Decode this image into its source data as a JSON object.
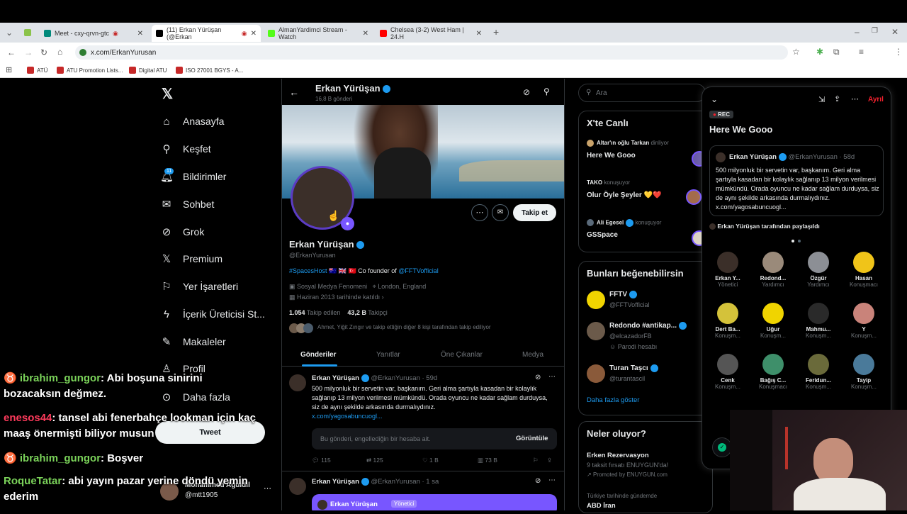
{
  "browser": {
    "tabs": [
      {
        "title": "Meet - cxy-qrvn-gtc"
      },
      {
        "title": "(11) Erkan Yürüşan (@Erkan"
      },
      {
        "title": "AlmanYardimci Stream - Watch"
      },
      {
        "title": "Chelsea (3-2) West Ham | 24.H"
      }
    ],
    "url": "x.com/ErkanYurusan",
    "bookmarks": [
      "ATÜ",
      "ATU Promotion Lists...",
      "Digital ATU",
      "ISO 27001 BGYS - A..."
    ]
  },
  "nav": {
    "items": [
      "Anasayfa",
      "Keşfet",
      "Bildirimler",
      "Sohbet",
      "Grok",
      "Premium",
      "Yer İşaretleri",
      "İçerik Üreticisi St...",
      "Makaleler",
      "Profil",
      "Daha fazla"
    ],
    "notif_badge": "11",
    "tweet_button": "Tweet",
    "account_name": "Mohammed Aguidil",
    "account_handle": "@mtt1905"
  },
  "profile": {
    "header_name": "Erkan Yürüşan",
    "header_posts": "16,8 B gönderi",
    "name": "Erkan Yürüşan",
    "handle": "@ErkanYurusan",
    "bio_tag": "#SpacesHost",
    "bio_flags": "🇦🇺 🇬🇧 🇹🇷",
    "bio_text": "Co founder of",
    "bio_link": "@FFTVofficial",
    "category": "Sosyal Medya Fenomeni",
    "location": "London, England",
    "joined": "Haziran 2013 tarihinde katıldı",
    "following_count": "1.054",
    "following_label": "Takip edilen",
    "followers_count": "43,2 B",
    "followers_label": "Takipçi",
    "followed_by": "Ahmet, Yiğit Zıngır ve takip ettiğin diğer 8 kişi tarafından takip ediliyor",
    "follow_button": "Takip et",
    "tabs": [
      "Gönderiler",
      "Yanıtlar",
      "Öne Çıkanlar",
      "Medya"
    ]
  },
  "post1": {
    "name": "Erkan Yürüşan",
    "handle": "@ErkanYurusan · 59d",
    "text": "500 milyonluk bir servetin var, başkanım. Geri alma şartıyla kasadan bir kolaylık sağlanıp 13 milyon verilmesi mümkündü. Orada oyuncu ne kadar sağlam durduysa, siz de aynı şekilde arkasında durmalıydınız.",
    "link": "x.com/yagosabuncuogl...",
    "blocked_text": "Bu gönderi, engellediğin bir hesaba ait.",
    "view_button": "Görüntüle",
    "replies": "115",
    "retweets": "125",
    "likes": "1 B",
    "views": "73 B"
  },
  "post2": {
    "name": "Erkan Yürüşan",
    "handle": "@ErkanYurusan · 1 sa",
    "embed_name": "Erkan Yürüşan",
    "embed_role": "Yönetici"
  },
  "right": {
    "search_placeholder": "Ara",
    "live_title": "X'te Canlı",
    "live": [
      {
        "host": "Altar'ın oğlu Tarkan",
        "status": "dinliyor",
        "title": "Here We Gooo"
      },
      {
        "host": "TAKO",
        "status": "konuşuyor",
        "title": "Olur Öyle Şeyler 💛❤️"
      },
      {
        "host": "Ali Egesel",
        "status": "konuşuyor",
        "title": "GSSpace"
      }
    ],
    "suggest_title": "Bunları beğenebilirsin",
    "suggest": [
      {
        "name": "FFTV",
        "handle": "@FFTVofficial",
        "note": ""
      },
      {
        "name": "Redondo #antikap...",
        "handle": "@elcazadorFB",
        "note": "Parodi hesabı"
      },
      {
        "name": "Turan Taşcı",
        "handle": "@turantascil",
        "note": ""
      }
    ],
    "show_more": "Daha fazla göster",
    "trends_title": "Neler oluyor?",
    "trends": [
      {
        "title": "Erken Rezervasyon",
        "sub": "9 taksit fırsatı ENUYGUN'da!",
        "promo": "Promoted by ENUYGUN.com"
      },
      {
        "title": "ABD İran",
        "sub": "Türkiye tarihinde gündemde",
        "promo": ""
      }
    ]
  },
  "space": {
    "rec": "REC",
    "leave": "Ayrıl",
    "title": "Here We Gooo",
    "pinned_name": "Erkan Yürüşan",
    "pinned_handle": "@ErkanYurusan · 58d",
    "pinned_text": "500 milyonluk bir servetin var, başkanım. Geri alma şartıyla kasadan bir kolaylık sağlanıp 13 milyon verilmesi mümkündü. Orada oyuncu ne kadar sağlam durduysa, siz de aynı şekilde arkasında durmalıydınız. x.com/yagosabuncuogl...",
    "shared_by": "Erkan Yürüşan tarafından paylaşıldı",
    "speakers": [
      {
        "name": "Erkan Y...",
        "role": "Yönetici"
      },
      {
        "name": "Redond...",
        "role": "Yardımcı"
      },
      {
        "name": "Özgür",
        "role": "Yardımcı"
      },
      {
        "name": "Hasan",
        "role": "Konuşmacı"
      },
      {
        "name": "Dert Ba...",
        "role": "Konuşm..."
      },
      {
        "name": "Uğur",
        "role": "Konuşm..."
      },
      {
        "name": "Mahmu...",
        "role": "Konuşm..."
      },
      {
        "name": "Y",
        "role": "Konuşm..."
      },
      {
        "name": "Cenk",
        "role": "Konuşm..."
      },
      {
        "name": "Bağış C...",
        "role": "Konuşmacı"
      },
      {
        "name": "Feridun...",
        "role": "Konuşm..."
      },
      {
        "name": "Tayip",
        "role": "Konuşm..."
      }
    ]
  },
  "chat": [
    {
      "user": "ibrahim_gungor",
      "msg": ": Abi boşuna sinirini bozacaksın değmez.",
      "color": "#7bd35a"
    },
    {
      "user": "enesos44",
      "msg": ": tansel abi fenerbahçe lookman için kaç maaş önermişti biliyor musun",
      "color": "#ff3b5c"
    },
    {
      "user": "ibrahim_gungor",
      "msg": ": Boşver",
      "color": "#7bd35a"
    },
    {
      "user": "RoqueTatar",
      "msg": ": abi yayın pazar yerine döndü yemin ederim",
      "color": "#7bd35a"
    }
  ],
  "colors": {
    "accent": "#1d9bf0",
    "bg": "#000000",
    "border": "#2f3336",
    "muted": "#71767b",
    "rec": "#f4212e"
  }
}
